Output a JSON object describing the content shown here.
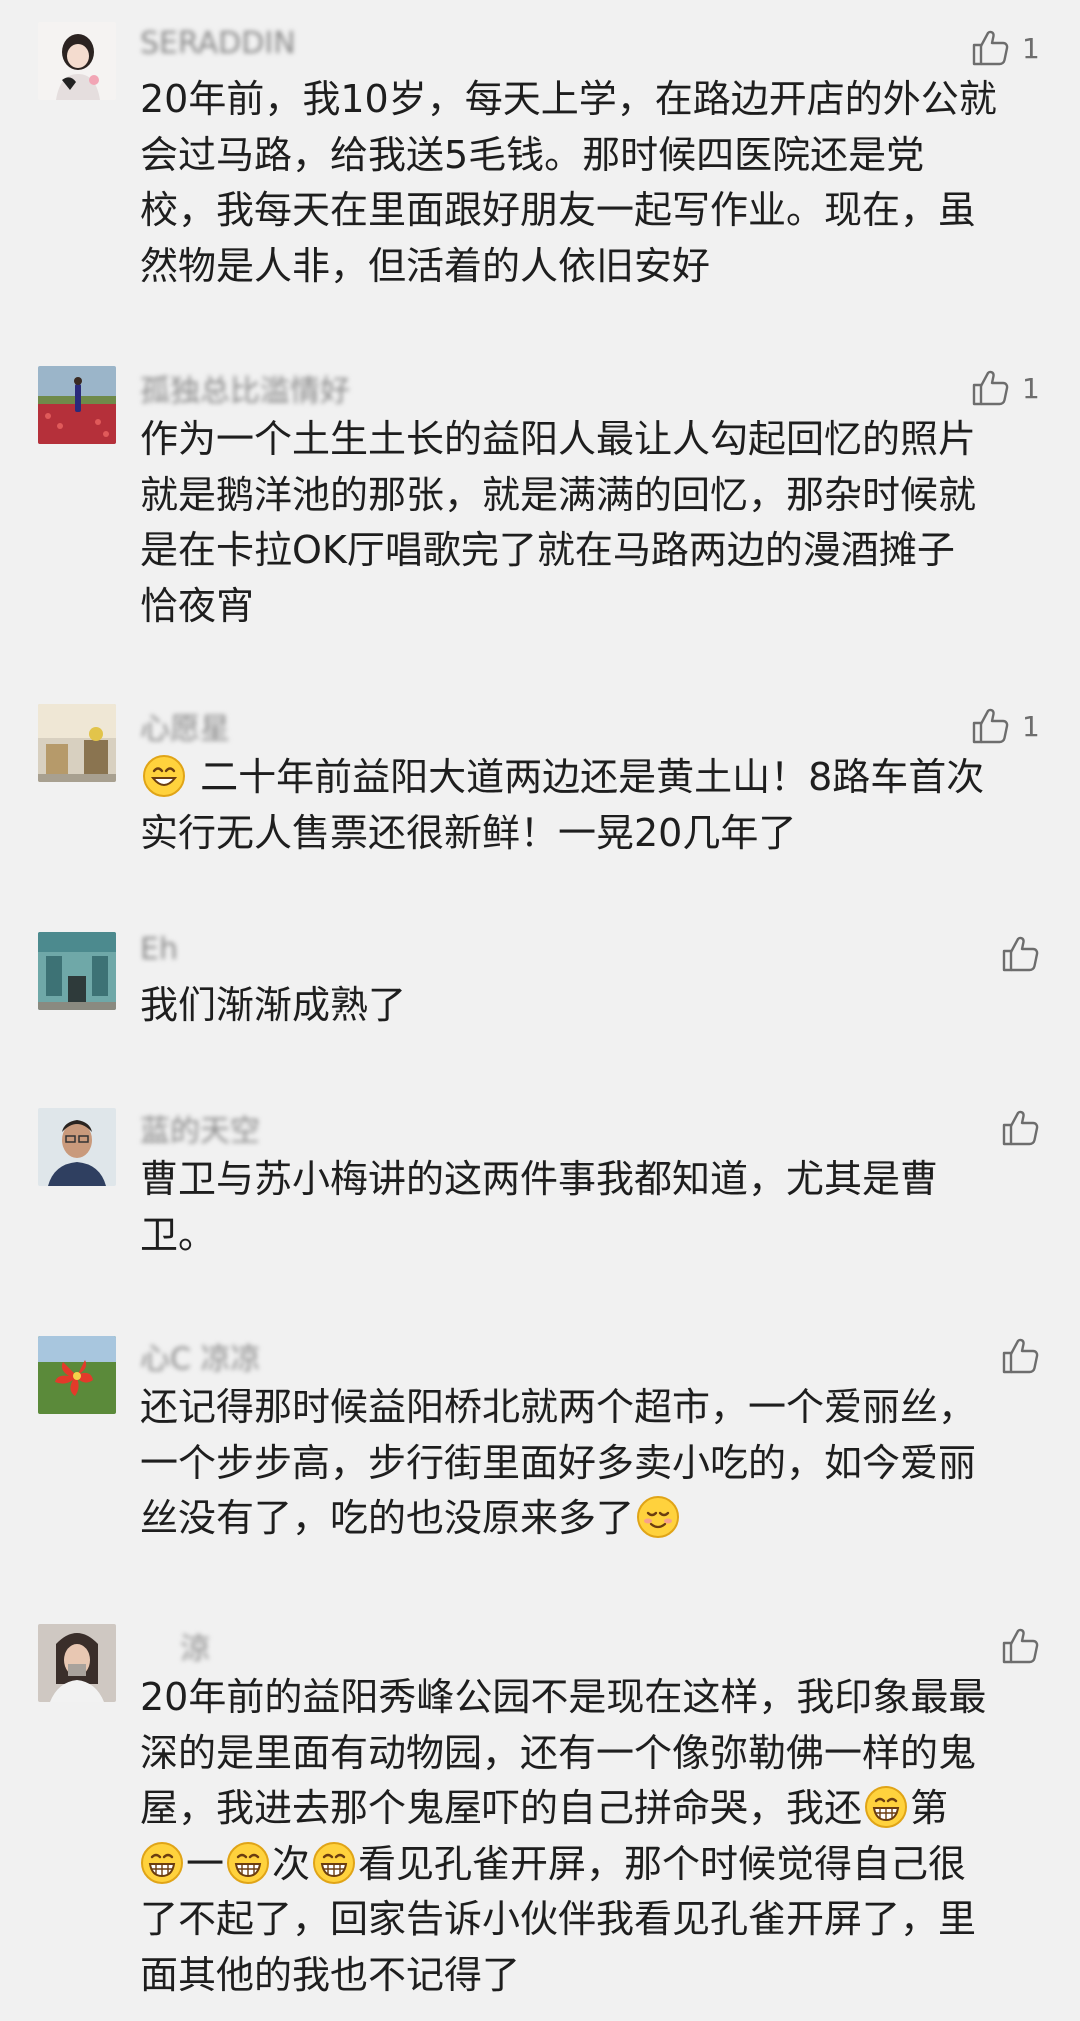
{
  "comments": [
    {
      "nick": "SERADDIN",
      "likes": "1",
      "lines": [
        "20年前，我10岁，每天上学，在路边开店的外公就",
        "会过马路，给我送5毛钱。那时候四医院还是党",
        "校，我每天在里面跟好朋友一起写作业。现在，虽",
        "然物是人非，但活着的人依旧安好"
      ]
    },
    {
      "nick": "孤独总比滥情好",
      "likes": "1",
      "lines": [
        "作为一个土生土长的益阳人最让人勾起回忆的照片",
        "就是鹅洋池的那张，就是满满的回忆，那杂时候就",
        "是在卡拉OK厅唱歌完了就在马路两边的漫酒摊子",
        "恰夜宵"
      ]
    },
    {
      "nick": "心愿星",
      "likes": "1",
      "lines": [
        "二十年前益阳大道两边还是黄土山！8路车首次",
        "实行无人售票还很新鲜！一晃20几年了"
      ]
    },
    {
      "nick": "Eh",
      "likes": "",
      "lines": [
        "我们渐渐成熟了"
      ]
    },
    {
      "nick": "蓝的天空",
      "likes": "",
      "lines": [
        "曹卫与苏小梅讲的这两件事我都知道，尤其是曹",
        "卫。"
      ]
    },
    {
      "nick": "心C 凉凉",
      "likes": "",
      "lines": [
        "还记得那时候益阳桥北就两个超市，一个爱丽丝，",
        "一个步步高，步行街里面好多卖小吃的，如今爱丽",
        "丝没有了，吃的也没原来多了"
      ]
    },
    {
      "nick": "涼",
      "likes": "",
      "lines": [
        "20年前的益阳秀峰公园不是现在这样，我印象最最",
        "深的是里面有动物园，还有一个像弥勒佛一样的鬼",
        "屋，我进去那个鬼屋吓的自己拼命哭，我还",
        "第",
        "一",
        "次",
        "看见孔雀开屏，那个时候觉得自己很",
        "了不起了，回家告诉小伙伴我看见孔雀开屏了，里",
        "面其他的我也不记得了"
      ]
    }
  ],
  "icons": {
    "like": "thumbs-up-icon",
    "smile": "smiling-face-emoji",
    "grin": "grinning-face-emoji"
  },
  "colors": {
    "background": "#f1f1f1",
    "nickname": "#8a8a8a",
    "text": "#1e1e1e",
    "icon": "#6d6d6d"
  }
}
